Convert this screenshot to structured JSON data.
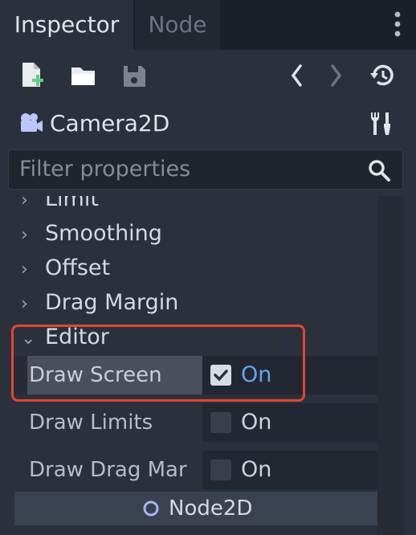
{
  "tabs": {
    "inspector": "Inspector",
    "node": "Node"
  },
  "object": {
    "name": "Camera2D"
  },
  "filter": {
    "placeholder": "Filter properties"
  },
  "sections": {
    "limit": "Limit",
    "smoothing": "Smoothing",
    "offset": "Offset",
    "drag_margin": "Drag Margin",
    "editor": "Editor"
  },
  "properties": [
    {
      "label": "Draw Screen",
      "value": "On",
      "checked": true
    },
    {
      "label": "Draw Limits",
      "value": "On",
      "checked": false
    },
    {
      "label": "Draw Drag Mar",
      "value": "On",
      "checked": false
    }
  ],
  "inherited": {
    "class_name": "Node2D"
  },
  "colors": {
    "accent": "#63a4f0",
    "highlight_border": "#e2472f",
    "panel_bg": "#2b313c"
  },
  "icons": [
    "new-resource-icon",
    "open-folder-icon",
    "save-icon",
    "back-icon",
    "forward-icon",
    "history-icon",
    "camera-icon",
    "tools-icon",
    "search-icon",
    "kebab-menu-icon",
    "chevron-right-icon",
    "chevron-down-icon",
    "checkmark-icon",
    "node2d-icon"
  ]
}
